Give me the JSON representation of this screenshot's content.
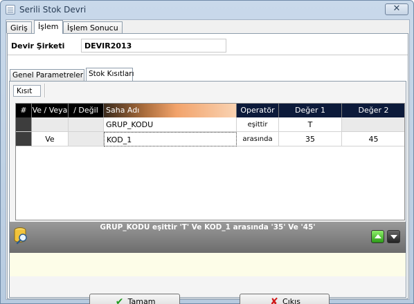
{
  "window": {
    "title": "Serili Stok Devri",
    "close_glyph": "✕"
  },
  "tabs": [
    {
      "label": "Giriş"
    },
    {
      "label": "İşlem",
      "active": true
    },
    {
      "label": "İşlem Sonucu"
    }
  ],
  "company": {
    "label": "Devir Şirketi",
    "value": "DEVIR2013"
  },
  "param_tabs": [
    {
      "label": "Genel Parametreler"
    },
    {
      "label": "Stok Kısıtları",
      "active": true
    }
  ],
  "kisit_tab": "Kısıt",
  "grid": {
    "columns": [
      "#",
      "Ve / Veya",
      "/ Değil",
      "Saha Adı",
      "Operatör",
      "Değer 1",
      "Değer 2"
    ],
    "rows": [
      {
        "ve_veya": "",
        "degil": "",
        "saha": "GRUP_KODU",
        "operator": "eşittir",
        "deger1": "T",
        "deger2": ""
      },
      {
        "ve_veya": "Ve",
        "degil": "",
        "saha": "KOD_1",
        "operator": "arasında",
        "deger1": "35",
        "deger2": "45"
      }
    ]
  },
  "filter_summary": "GRUP_KODU eşittir 'T' Ve KOD_1 arasında '35' Ve '45'",
  "buttons": {
    "ok": "Tamam",
    "cancel": "Çıkış"
  },
  "icons": {
    "app": "stock-transfer-icon",
    "db": "database-search-icon",
    "ok": "checkmark-icon",
    "cancel": "x-icon",
    "up": "arrow-up-icon",
    "down": "arrow-down-icon"
  },
  "colors": {
    "header_bg": "#000000",
    "header_navy": "#0c1a3a",
    "filter_bar": "#7a7a7a",
    "note_bg": "#fdfde8",
    "up_btn": "#3fb51f"
  }
}
